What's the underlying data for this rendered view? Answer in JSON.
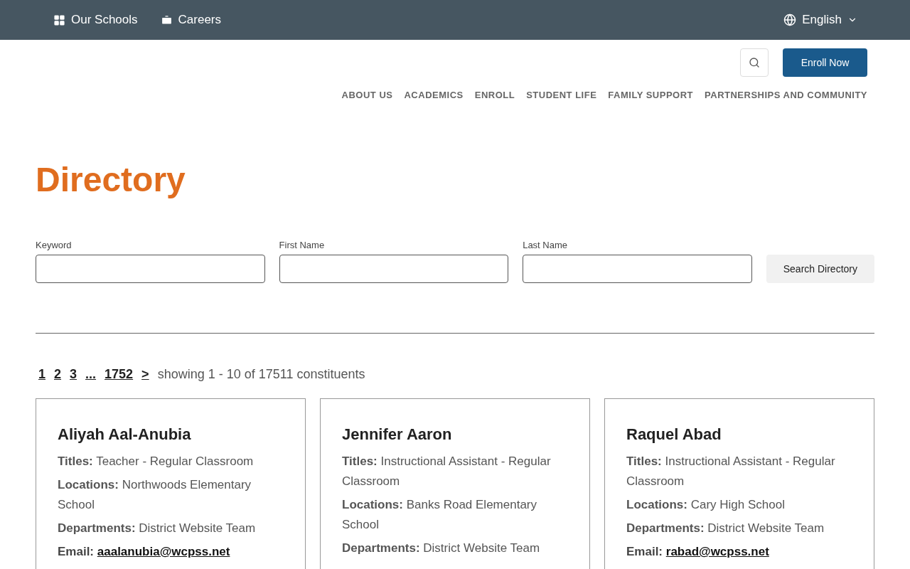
{
  "top_bar": {
    "links": [
      {
        "kind": "grid",
        "label": "Our Schools"
      },
      {
        "kind": "briefcase",
        "label": "Careers"
      }
    ],
    "language": "English"
  },
  "header": {
    "enroll_button": "Enroll Now",
    "nav": [
      "ABOUT US",
      "ACADEMICS",
      "ENROLL",
      "STUDENT LIFE",
      "FAMILY SUPPORT",
      "PARTNERSHIPS AND COMMUNITY"
    ]
  },
  "title": "Directory",
  "search": {
    "fields": [
      {
        "label": "Keyword"
      },
      {
        "label": "First Name"
      },
      {
        "label": "Last Name"
      }
    ],
    "button": "Search Directory"
  },
  "pagination": {
    "pages": [
      "1",
      "2",
      "3",
      "...",
      "1752",
      ">"
    ],
    "summary": "showing 1 - 10 of 17511 constituents"
  },
  "cards": [
    {
      "name": "Aliyah Aal-Anubia",
      "fields": [
        "**Titles:** Teacher - Regular Classroom",
        "**Locations:** Northwoods Elementary School",
        "**Departments:** District Website Team"
      ],
      "email_label": "Email:",
      "email": "aaalanubia@wcpss.net"
    },
    {
      "name": "Jennifer Aaron",
      "fields": [
        "**Titles:** Instructional Assistant - Regular Classroom",
        "**Locations:** Banks Road Elementary School",
        "**Departments:** District Website Team"
      ]
    },
    {
      "name": "Raquel Abad",
      "fields": [
        "**Titles:** Instructional Assistant - Regular Classroom",
        "**Locations:** Cary High School",
        "**Departments:** District Website Team"
      ],
      "email_label": "Email:",
      "email": "rabad@wcpss.net"
    }
  ]
}
